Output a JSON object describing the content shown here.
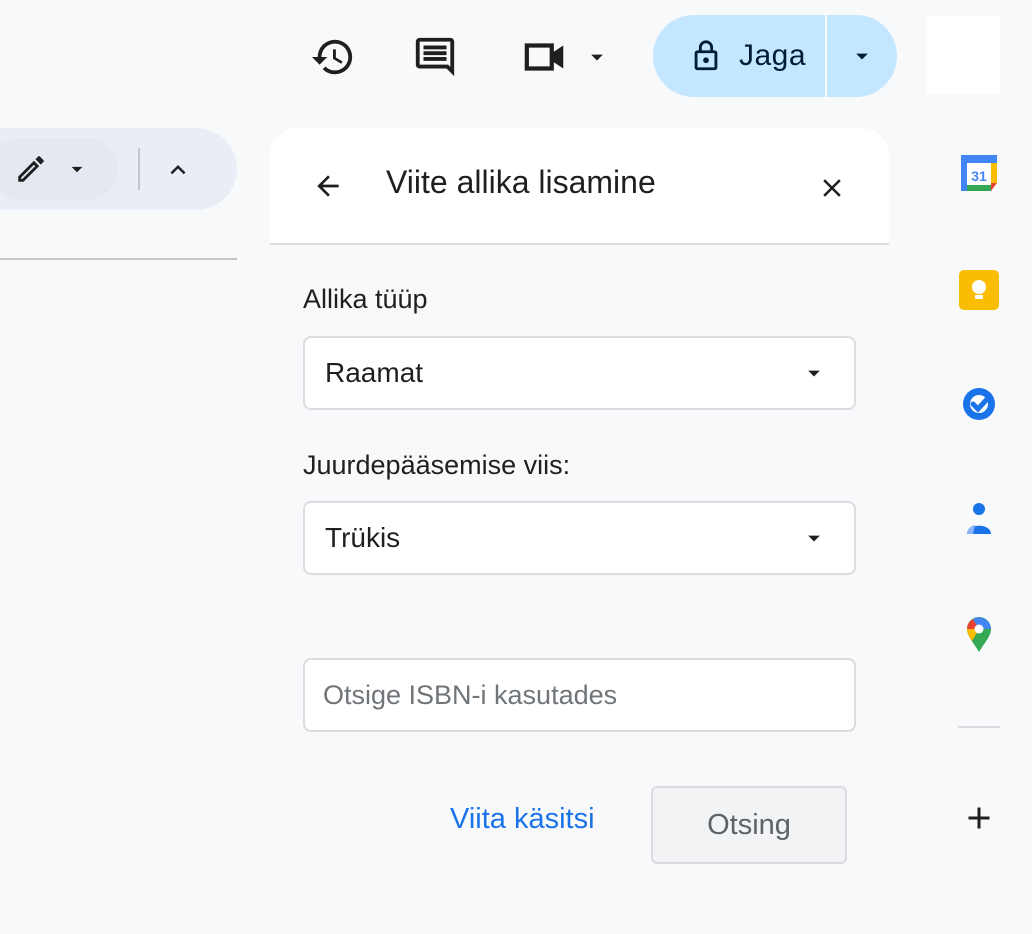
{
  "topbar": {
    "share_label": "Jaga"
  },
  "panel": {
    "title": "Viite allika lisamine",
    "source_type_label": "Allika tüüp",
    "source_type_value": "Raamat",
    "access_label": "Juurdepääsemise viis:",
    "access_value": "Trükis",
    "isbn_placeholder": "Otsige ISBN-i kasutades",
    "isbn_value": "",
    "manual_link": "Viita käsitsi",
    "search_button": "Otsing"
  },
  "sidebar": {
    "calendar_day": "31",
    "apps": [
      "calendar-icon",
      "keep-icon",
      "tasks-icon",
      "contacts-icon",
      "maps-icon"
    ]
  },
  "colors": {
    "accent": "#1a73e8",
    "share_bg": "#c2e7ff",
    "panel_bg": "#f8f9fa"
  }
}
